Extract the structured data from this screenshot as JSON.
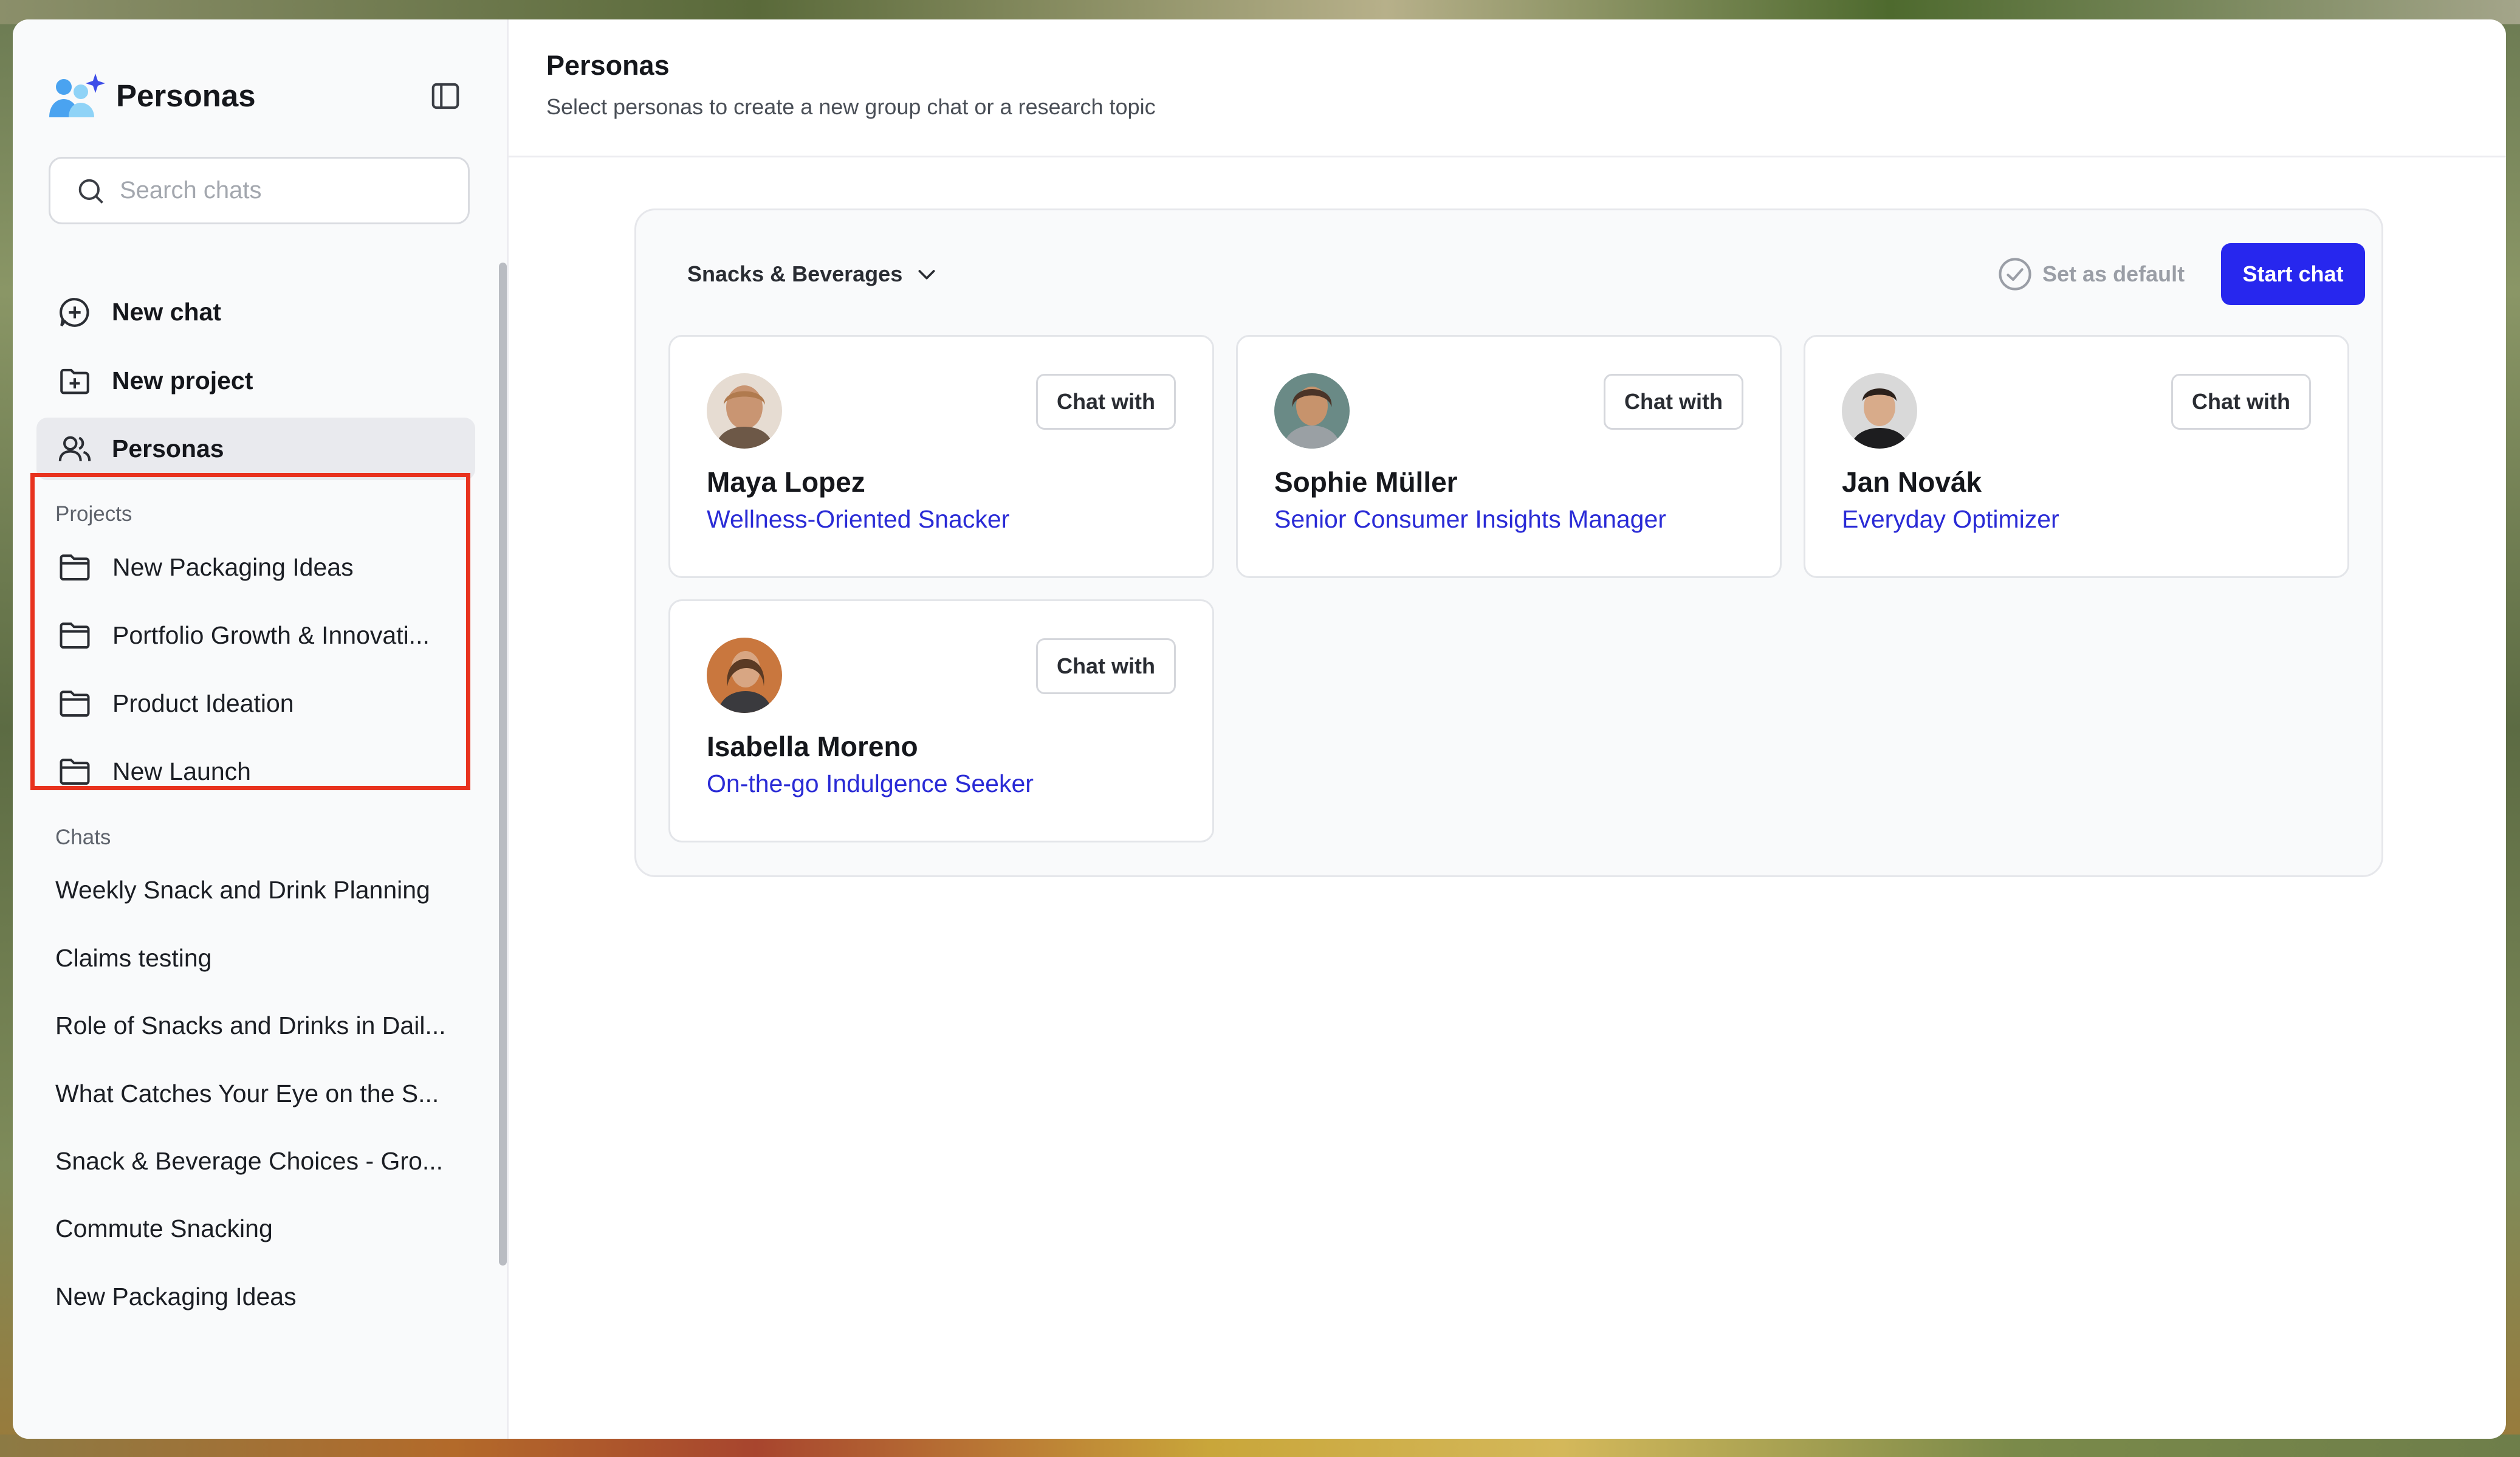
{
  "app": {
    "title": "Personas",
    "brand_color": "#2727ee",
    "highlight_color": "#e8321e"
  },
  "sidebar": {
    "search_placeholder": "Search chats",
    "nav": [
      {
        "label": "New chat",
        "icon": "chat-plus-icon"
      },
      {
        "label": "New project",
        "icon": "folder-plus-icon"
      },
      {
        "label": "Personas",
        "icon": "users-icon",
        "active": true
      }
    ],
    "projects_label": "Projects",
    "projects": [
      {
        "label": "New Packaging Ideas",
        "icon": "folder-icon"
      },
      {
        "label": "Portfolio Growth & Innovati...",
        "icon": "folder-icon"
      },
      {
        "label": "Product Ideation",
        "icon": "folder-icon"
      },
      {
        "label": "New Launch",
        "icon": "folder-icon"
      }
    ],
    "chats_label": "Chats",
    "chats": [
      {
        "label": "Weekly Snack and Drink Planning"
      },
      {
        "label": "Claims testing"
      },
      {
        "label": "Role of Snacks and Drinks in Dail..."
      },
      {
        "label": "What Catches Your Eye on the S..."
      },
      {
        "label": "Snack & Beverage Choices - Gro..."
      },
      {
        "label": "Commute Snacking"
      },
      {
        "label": "New Packaging Ideas"
      }
    ]
  },
  "main": {
    "title": "Personas",
    "subtitle": "Select personas to create a new group chat or a research topic",
    "category": "Snacks & Beverages",
    "set_default_label": "Set as default",
    "start_chat_label": "Start chat",
    "chat_with_label": "Chat with",
    "personas": [
      {
        "name": "Maya Lopez",
        "role": "Wellness-Oriented Snacker"
      },
      {
        "name": "Sophie Müller",
        "role": "Senior Consumer Insights Manager"
      },
      {
        "name": "Jan Novák",
        "role": "Everyday Optimizer"
      },
      {
        "name": "Isabella Moreno",
        "role": "On-the-go Indulgence Seeker"
      }
    ]
  }
}
